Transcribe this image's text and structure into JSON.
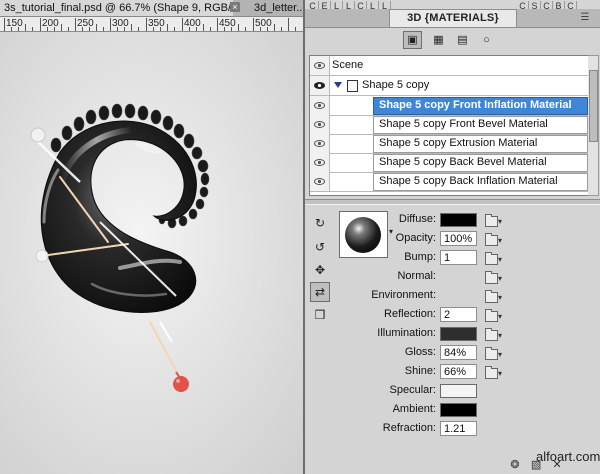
{
  "document_tabs": [
    {
      "label": "3s_tutorial_final.psd @ 66.7% (Shape 9, RGB/8...",
      "active": true
    },
    {
      "label": "3d_letter...",
      "active": false
    }
  ],
  "tab_close_symbol": "×",
  "ruler": {
    "marks": [
      "150",
      "200",
      "250",
      "300",
      "350",
      "400",
      "450",
      "500"
    ]
  },
  "top_strip": {
    "letters": [
      "C",
      "E",
      "L",
      "L",
      "C",
      "L",
      "L",
      "C",
      "S",
      "C",
      "B",
      "C"
    ]
  },
  "panel": {
    "tab_label": "3D {MATERIALS}",
    "menu_icon": "panel-menu-icon",
    "toolbar_icons": [
      "scene-filter-icon",
      "mesh-filter-icon",
      "materials-filter-icon",
      "lights-filter-icon"
    ],
    "toolbar_glyphs": [
      "▣",
      "▦",
      "▤",
      "○"
    ]
  },
  "scene": {
    "header": "Scene",
    "group": "Shape 5 copy",
    "materials": [
      {
        "label": "Shape 5 copy Front Inflation Material",
        "selected": true
      },
      {
        "label": "Shape 5 copy Front Bevel Material",
        "selected": false
      },
      {
        "label": "Shape 5 copy Extrusion Material",
        "selected": false
      },
      {
        "label": "Shape 5 copy Back Bevel Material",
        "selected": false
      },
      {
        "label": "Shape 5 copy Back Inflation Material",
        "selected": false
      }
    ]
  },
  "tools": [
    {
      "icon": "rotate-material-icon",
      "glyph": "↻"
    },
    {
      "icon": "roll-material-icon",
      "glyph": "↺"
    },
    {
      "icon": "drag-material-icon",
      "glyph": "✥"
    },
    {
      "icon": "slide-material-icon",
      "glyph": "⇄"
    },
    {
      "icon": "material-drop-icon",
      "glyph": "❒"
    }
  ],
  "tool_active_index": 3,
  "preview_dropdown_glyph": "▾",
  "properties": [
    {
      "label": "Diffuse:",
      "kind": "swatch",
      "color": "#000000"
    },
    {
      "label": "Opacity:",
      "kind": "value",
      "value": "100%"
    },
    {
      "label": "Bump:",
      "kind": "value",
      "value": "1"
    },
    {
      "label": "Normal:",
      "kind": "none"
    },
    {
      "label": "Environment:",
      "kind": "none"
    },
    {
      "label": "Reflection:",
      "kind": "value",
      "value": "2"
    },
    {
      "label": "Illumination:",
      "kind": "swatch",
      "color": "#2e2e2e"
    },
    {
      "label": "Gloss:",
      "kind": "value",
      "value": "84%"
    },
    {
      "label": "Shine:",
      "kind": "value",
      "value": "66%"
    },
    {
      "label": "Specular:",
      "kind": "swatch",
      "color": "#f5f5f5"
    },
    {
      "label": "Ambient:",
      "kind": "swatch",
      "color": "#000000"
    },
    {
      "label": "Refraction:",
      "kind": "value",
      "value": "1.21"
    }
  ],
  "watermark": "alfoart.com",
  "bottom_icons": [
    "select-material-icon",
    "load-texture-icon",
    "delete-material-icon"
  ],
  "bottom_glyphs": [
    "❂",
    "▧",
    "✕"
  ],
  "colors": {
    "selection": "#3f86d8",
    "light_guide": "#f2d6b4",
    "light_widget": "#e0524a"
  }
}
